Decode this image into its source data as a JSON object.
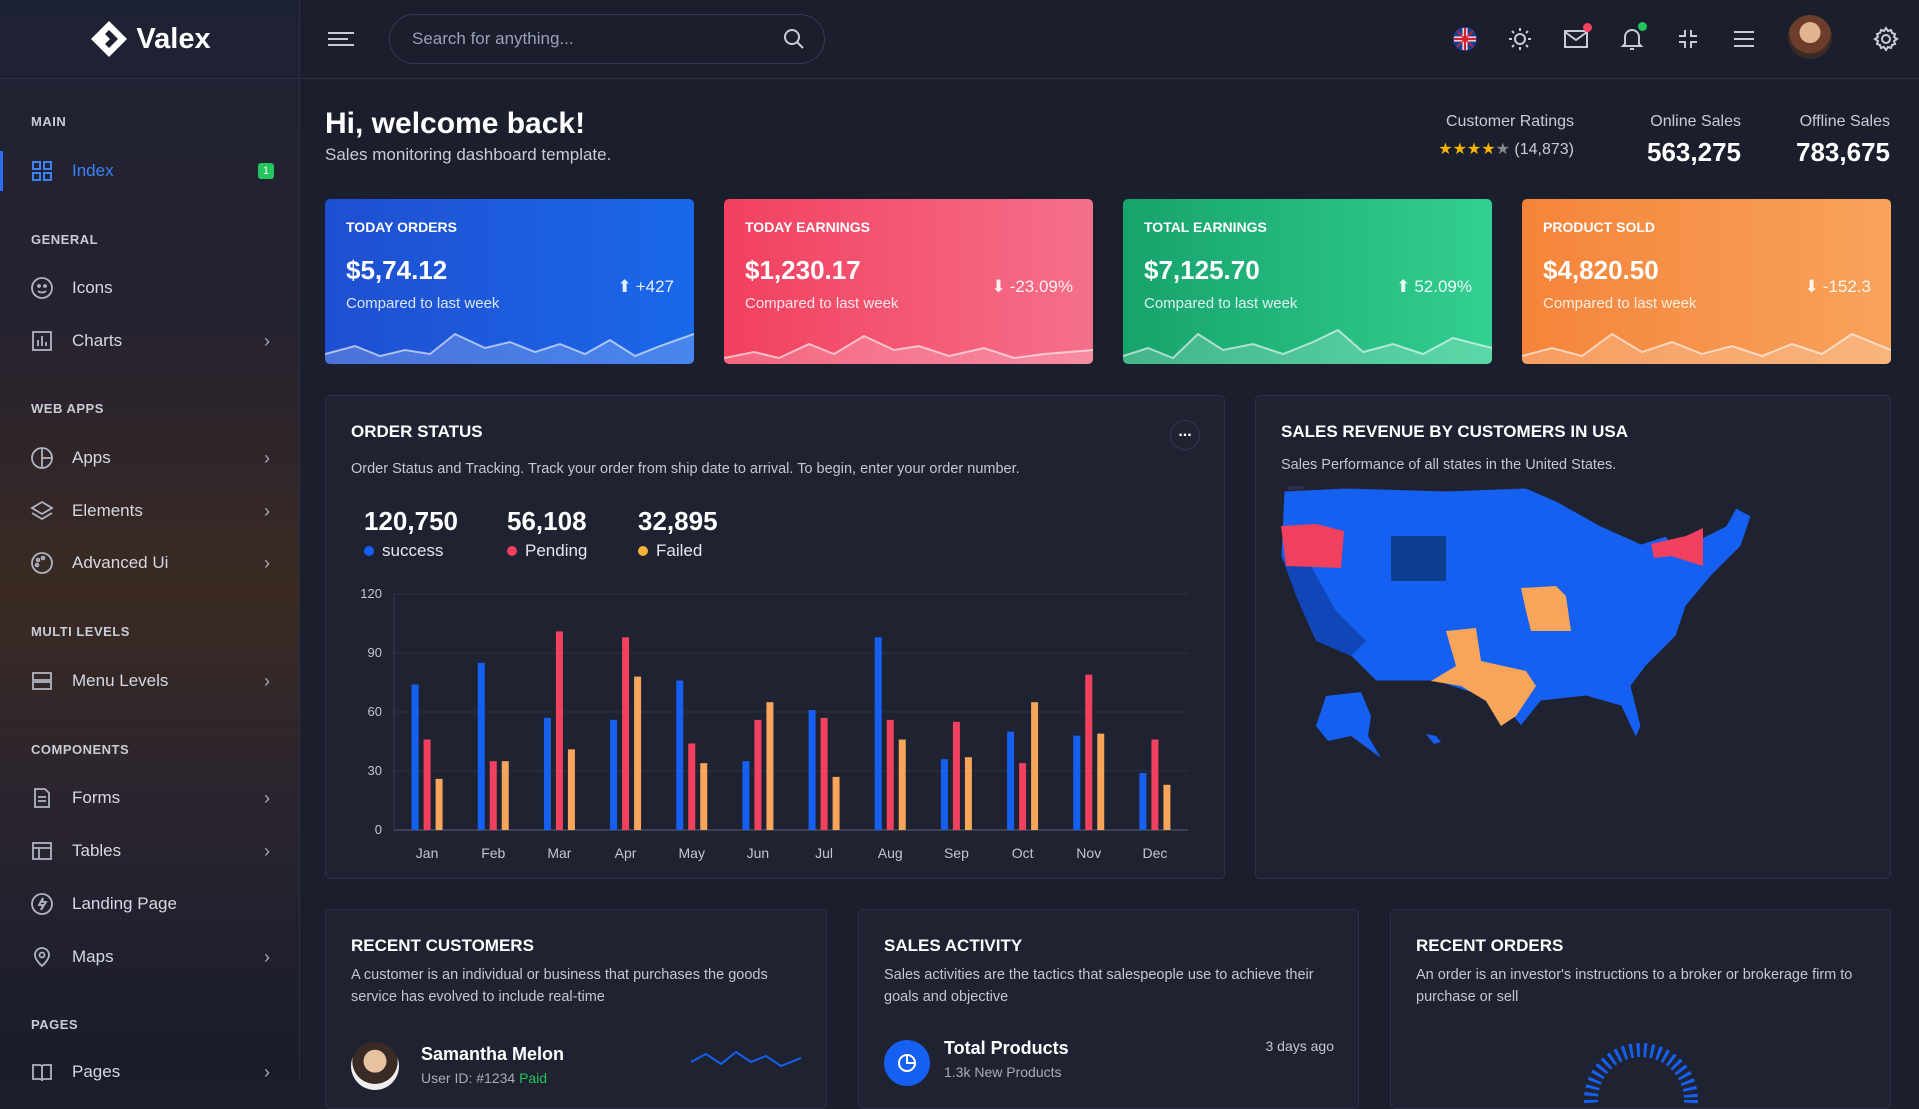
{
  "brand": {
    "name": "Valex"
  },
  "sidebar": {
    "sections": [
      "MAIN",
      "GENERAL",
      "WEB APPS",
      "MULTI LEVELS",
      "COMPONENTS",
      "PAGES"
    ],
    "items": [
      {
        "label": "Index",
        "badge": "1"
      },
      {
        "label": "Icons"
      },
      {
        "label": "Charts"
      },
      {
        "label": "Apps"
      },
      {
        "label": "Elements"
      },
      {
        "label": "Advanced Ui"
      },
      {
        "label": "Menu Levels"
      },
      {
        "label": "Forms"
      },
      {
        "label": "Tables"
      },
      {
        "label": "Landing Page"
      },
      {
        "label": "Maps"
      },
      {
        "label": "Pages"
      }
    ]
  },
  "search": {
    "placeholder": "Search for anything..."
  },
  "header": {
    "title": "Hi, welcome back!",
    "subtitle": "Sales monitoring dashboard template."
  },
  "stats": {
    "ratings_label": "Customer Ratings",
    "ratings_count": "(14,873)",
    "rating_stars": 4,
    "online_label": "Online Sales",
    "online_value": "563,275",
    "offline_label": "Offline Sales",
    "offline_value": "783,675"
  },
  "cards": [
    {
      "title": "TODAY ORDERS",
      "value": "$5,74.12",
      "compare": "Compared to last week",
      "change": "+427",
      "direction": "up",
      "color": "#1b5bd9"
    },
    {
      "title": "TODAY EARNINGS",
      "value": "$1,230.17",
      "compare": "Compared to last week",
      "change": "-23.09%",
      "direction": "down",
      "color": "#f2496a"
    },
    {
      "title": "TOTAL EARNINGS",
      "value": "$7,125.70",
      "compare": "Compared to last week",
      "change": "52.09%",
      "direction": "up",
      "color": "#1fb079"
    },
    {
      "title": "PRODUCT SOLD",
      "value": "$4,820.50",
      "compare": "Compared to last week",
      "change": "-152.3",
      "direction": "down",
      "color": "#f5843a"
    }
  ],
  "order_status": {
    "title": "ORDER STATUS",
    "description": "Order Status and Tracking. Track your order from ship date to arrival. To begin, enter your order number.",
    "menu": "...",
    "kpis": [
      {
        "value": "120,750",
        "label": "success",
        "color": "#1560f0"
      },
      {
        "value": "56,108",
        "label": "Pending",
        "color": "#f2405f"
      },
      {
        "value": "32,895",
        "label": "Failed",
        "color": "#f6b23b"
      }
    ]
  },
  "chart_data": {
    "type": "bar",
    "categories": [
      "Jan",
      "Feb",
      "Mar",
      "Apr",
      "May",
      "Jun",
      "Jul",
      "Aug",
      "Sep",
      "Oct",
      "Nov",
      "Dec"
    ],
    "series": [
      {
        "name": "success",
        "values": [
          74,
          85,
          57,
          56,
          76,
          35,
          61,
          98,
          36,
          50,
          48,
          29
        ]
      },
      {
        "name": "Pending",
        "values": [
          46,
          35,
          101,
          98,
          44,
          56,
          57,
          56,
          55,
          34,
          79,
          46
        ]
      },
      {
        "name": "Failed",
        "values": [
          26,
          35,
          41,
          78,
          34,
          65,
          27,
          46,
          37,
          65,
          49,
          23
        ]
      }
    ],
    "ylim": [
      0,
      120
    ],
    "yticks": [
      0,
      30,
      60,
      90,
      120
    ],
    "colors": [
      "#1560f0",
      "#f2405f",
      "#f6a55a"
    ],
    "grid": true
  },
  "map": {
    "title": "SALES REVENUE BY CUSTOMERS IN USA",
    "description": "Sales Performance of all states in the United States.",
    "zoom_in": "+",
    "zoom_out": "−"
  },
  "recent_customers": {
    "title": "RECENT CUSTOMERS",
    "description": "A customer is an individual or business that purchases the goods service has evolved to include real-time",
    "name": "Samantha Melon",
    "user_id": "User ID: #1234",
    "status": "Paid"
  },
  "sales_activity": {
    "title": "SALES ACTIVITY",
    "description": "Sales activities are the tactics that salespeople use to achieve their goals and objective",
    "item_title": "Total Products",
    "item_sub": "1.3k New Products",
    "item_time": "3 days ago"
  },
  "recent_orders": {
    "title": "RECENT ORDERS",
    "description": "An order is an investor's instructions to a broker or brokerage firm to purchase or sell"
  }
}
